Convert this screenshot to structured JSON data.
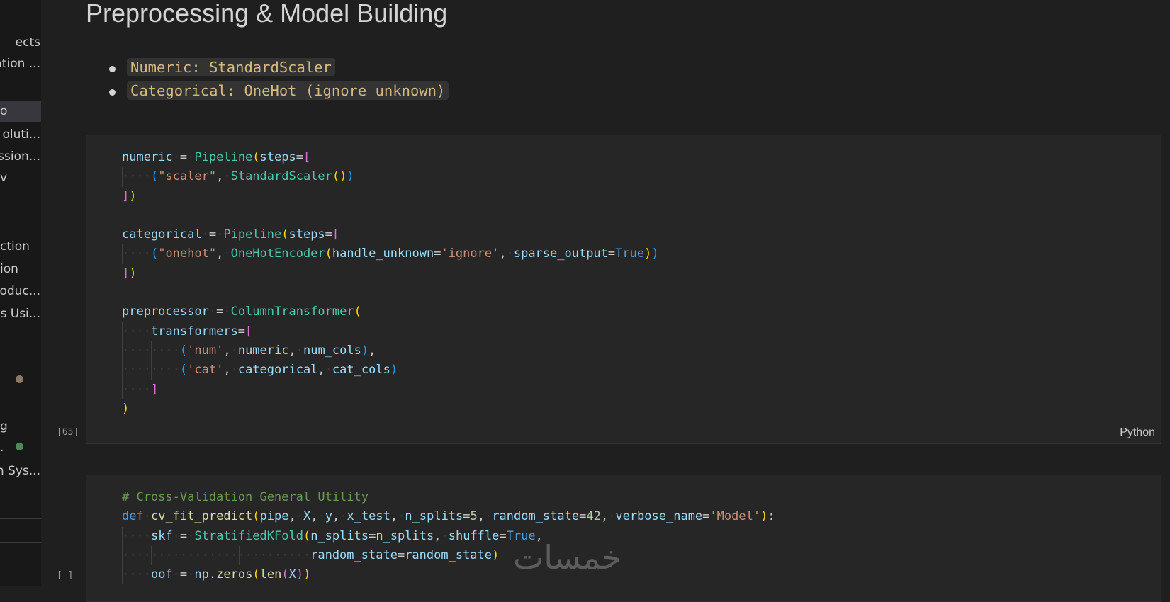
{
  "sidebar": {
    "items": [
      {
        "label": "ects"
      },
      {
        "label": "ation ..."
      },
      {
        "label": "o"
      },
      {
        "label": "oluti..."
      },
      {
        "label": "ission..."
      },
      {
        "label": "v"
      },
      {
        "label": "ction"
      },
      {
        "label": "ion"
      },
      {
        "label": "roduc..."
      },
      {
        "label": "es Usi..."
      },
      {
        "label": "g"
      },
      {
        "label": "."
      },
      {
        "label": "n Sys..."
      }
    ]
  },
  "notebook": {
    "heading": "Preprocessing & Model Building",
    "bullets": [
      "Numeric: StandardScaler",
      "Categorical: OneHot (ignore unknown)"
    ],
    "cells": [
      {
        "exec_count": "[65]",
        "language": "Python"
      },
      {
        "exec_count": "[ ]",
        "language": ""
      }
    ]
  },
  "code": {
    "c1": {
      "numeric": "numeric",
      "pipeline": "Pipeline",
      "steps": "steps",
      "scaler_str": "\"scaler\"",
      "standard_scaler": "StandardScaler",
      "categorical": "categorical",
      "onehot_str": "\"onehot\"",
      "onehot_encoder": "OneHotEncoder",
      "handle_unknown": "handle_unknown",
      "ignore_str": "'ignore'",
      "sparse_output": "sparse_output",
      "true": "True",
      "preprocessor": "preprocessor",
      "column_transformer": "ColumnTransformer",
      "transformers": "transformers",
      "num_str": "'num'",
      "num_cols": "num_cols",
      "cat_str": "'cat'",
      "cat_cols": "cat_cols"
    },
    "c2": {
      "comment": "# Cross-Validation General Utility",
      "def": "def",
      "fn_name": "cv_fit_predict",
      "pipe": "pipe",
      "X": "X",
      "y": "y",
      "x_test": "x_test",
      "n_splits": "n_splits",
      "n_splits_val": "5",
      "random_state": "random_state",
      "random_state_val": "42",
      "verbose_name": "verbose_name",
      "model_str": "'Model'",
      "skf": "skf",
      "skf_class": "StratifiedKFold",
      "shuffle": "shuffle",
      "true": "True",
      "oof": "oof",
      "np": "np",
      "zeros": "zeros",
      "len": "len"
    }
  },
  "watermark": "خمسات"
}
